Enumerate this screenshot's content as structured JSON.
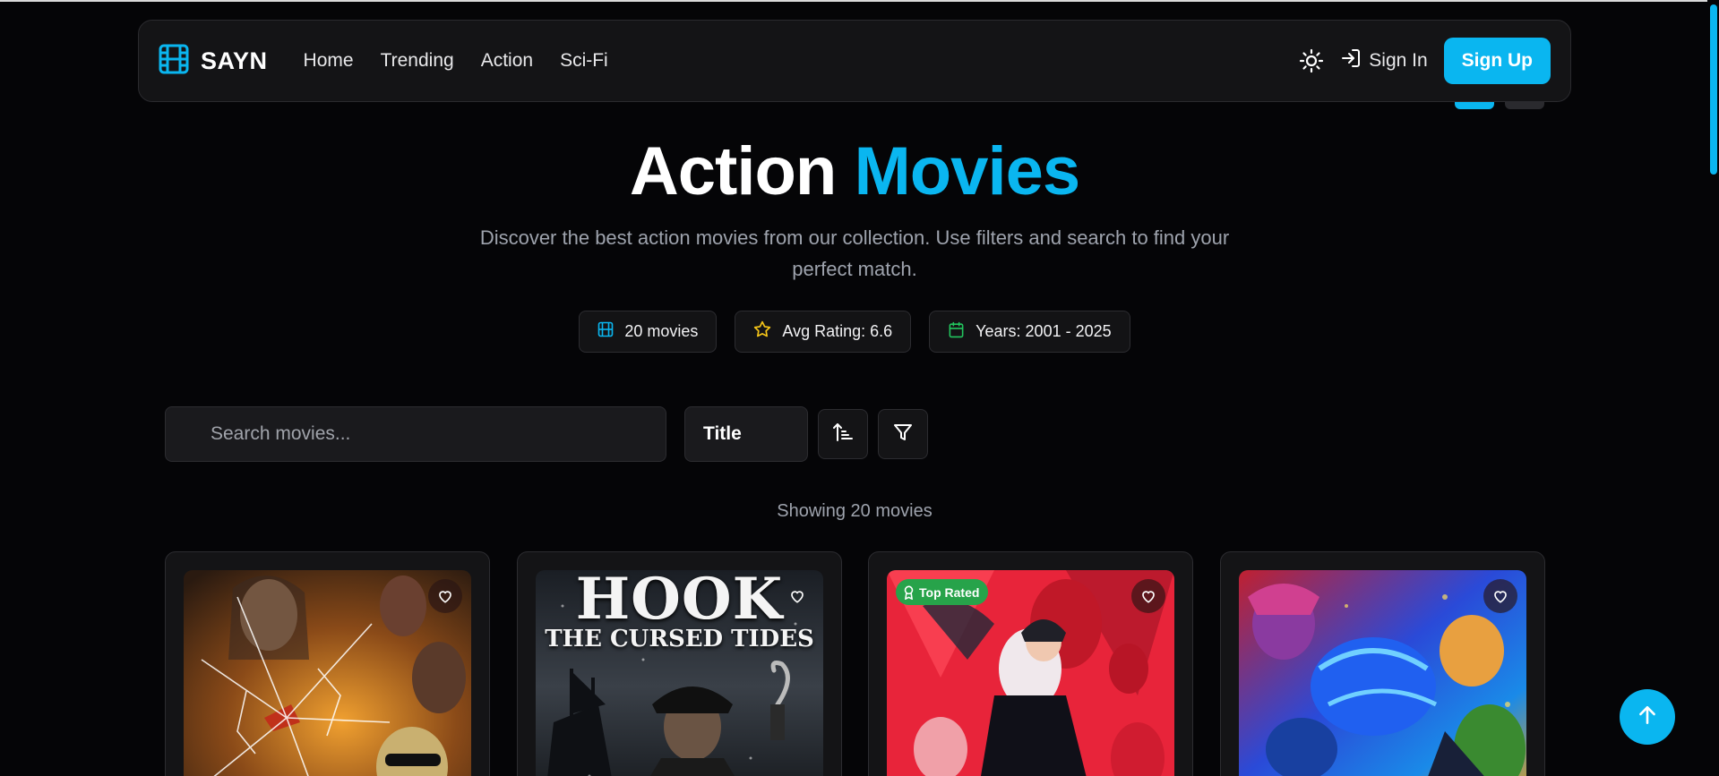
{
  "brand": {
    "name": "SAYN",
    "accent": "#0ab6f0"
  },
  "nav": {
    "links": [
      "Home",
      "Trending",
      "Action",
      "Sci-Fi"
    ],
    "sign_in": "Sign In",
    "sign_up": "Sign Up"
  },
  "hero": {
    "title_main": "Action",
    "title_accent": "Movies",
    "subtitle": "Discover the best action movies from our collection. Use filters and search to find your perfect match."
  },
  "stats": {
    "movies": "20 movies",
    "avg_rating": "Avg Rating: 6.6",
    "years": "Years: 2001 - 2025"
  },
  "controls": {
    "search_placeholder": "Search movies...",
    "sort_field": "Title"
  },
  "results": {
    "showing": "Showing 20 movies"
  },
  "cards": [
    {
      "badge": ""
    },
    {
      "poster_line1": "HOOK",
      "poster_line2": "THE CURSED TIDES",
      "badge": ""
    },
    {
      "badge": "Top Rated"
    },
    {
      "badge": ""
    }
  ]
}
